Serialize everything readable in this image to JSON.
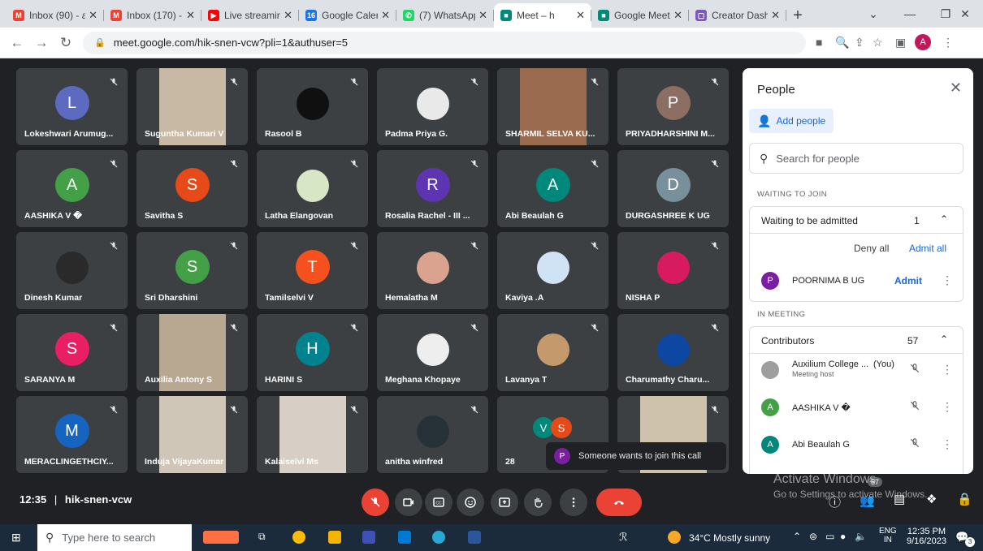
{
  "browser": {
    "tabs": [
      {
        "label": "Inbox (90) - a",
        "fav_color": "#ea4335",
        "fav_glyph": "M"
      },
      {
        "label": "Inbox (170) -",
        "fav_color": "#ea4335",
        "fav_glyph": "M"
      },
      {
        "label": "Live streamin",
        "fav_color": "#ff0000",
        "fav_glyph": "▶"
      },
      {
        "label": "Google Calen",
        "fav_color": "#1a73e8",
        "fav_glyph": "16"
      },
      {
        "label": "(7) WhatsApp",
        "fav_color": "#25d366",
        "fav_glyph": "✆"
      },
      {
        "label": "Meet – h",
        "fav_color": "#00897b",
        "fav_glyph": "■"
      },
      {
        "label": "Google Meet",
        "fav_color": "#00897b",
        "fav_glyph": "■"
      },
      {
        "label": "Creator Dash",
        "fav_color": "#7e57c2",
        "fav_glyph": "▢"
      }
    ],
    "new_tab": "+",
    "url": "meet.google.com/hik-snen-vcw?pli=1&authuser=5",
    "profile_initial": "A"
  },
  "participants": [
    {
      "name": "Lokeshwari Arumug...",
      "initial": "L",
      "color": "#5c6bc0",
      "type": "avatar"
    },
    {
      "name": "Suguntha Kumari V",
      "type": "video",
      "bg": "#c7b9a3"
    },
    {
      "name": "Rasool B",
      "type": "photo",
      "bg": "#101010"
    },
    {
      "name": "Padma Priya G.",
      "type": "photo",
      "bg": "#e9e9e9"
    },
    {
      "name": "SHARMIL SELVA KU...",
      "type": "video",
      "bg": "#9a6b4e"
    },
    {
      "name": "PRIYADHARSHINI M...",
      "initial": "P",
      "color": "#8d6e63",
      "type": "avatar"
    },
    {
      "name": "AASHIKA V �",
      "initial": "A",
      "color": "#43a047",
      "type": "avatar"
    },
    {
      "name": "Savitha S",
      "initial": "S",
      "color": "#e64a19",
      "type": "avatar"
    },
    {
      "name": "Latha Elangovan",
      "type": "photo",
      "bg": "#d7e6c5"
    },
    {
      "name": "Rosalia Rachel - III ...",
      "initial": "R",
      "color": "#5e35b1",
      "type": "avatar"
    },
    {
      "name": "Abi Beaulah G",
      "initial": "A",
      "color": "#00897b",
      "type": "avatar"
    },
    {
      "name": "DURGASHREE K UG",
      "initial": "D",
      "color": "#78909c",
      "type": "avatar"
    },
    {
      "name": "Dinesh Kumar",
      "type": "photo",
      "bg": "#2a2a2a"
    },
    {
      "name": "Sri Dharshini",
      "initial": "S",
      "color": "#43a047",
      "type": "avatar"
    },
    {
      "name": "Tamilselvi V",
      "initial": "T",
      "color": "#f4511e",
      "type": "avatar"
    },
    {
      "name": "Hemalatha M",
      "type": "photo",
      "bg": "#d9a38f"
    },
    {
      "name": "Kaviya .A",
      "type": "photo",
      "bg": "#cfe3f5"
    },
    {
      "name": "NISHA P",
      "type": "photo",
      "bg": "#d81b60"
    },
    {
      "name": "SARANYA M",
      "initial": "S",
      "color": "#e91e63",
      "type": "avatar"
    },
    {
      "name": "Auxilia Antony S",
      "type": "video",
      "bg": "#b9a891"
    },
    {
      "name": "HARINI S",
      "initial": "H",
      "color": "#00838f",
      "type": "avatar"
    },
    {
      "name": "Meghana Khopaye",
      "type": "photo",
      "bg": "#eeeeee"
    },
    {
      "name": "Lavanya T",
      "type": "photo",
      "bg": "#c49a6c"
    },
    {
      "name": "Charumathy Charu...",
      "type": "photo",
      "bg": "#0d47a1"
    },
    {
      "name": "MERACLINGETHCIY...",
      "initial": "M",
      "color": "#1565c0",
      "type": "avatar"
    },
    {
      "name": "Induja VijayaKumar",
      "type": "video",
      "bg": "#cfc6b8"
    },
    {
      "name": "Kalaiselvi Ms",
      "type": "video",
      "bg": "#d7cfc6"
    },
    {
      "name": "anitha winfred",
      "type": "photo",
      "bg": "#263238"
    },
    {
      "name": "28",
      "type": "more",
      "initials": [
        "V",
        "S"
      ],
      "colors": [
        "#00897b",
        "#e64a19"
      ]
    },
    {
      "name": "",
      "type": "video",
      "bg": "#cfc2ad"
    }
  ],
  "meeting": {
    "time": "12:35",
    "separator": "|",
    "code": "hik-snen-vcw"
  },
  "toast": {
    "avatar": "P",
    "text": "Someone wants to join this call"
  },
  "people": {
    "title": "People",
    "add_people": "Add people",
    "search_placeholder": "Search for people",
    "waiting_section": "WAITING TO JOIN",
    "waiting_label": "Waiting to be admitted",
    "waiting_count": "1",
    "deny_all": "Deny all",
    "admit_all": "Admit all",
    "waiting_person": {
      "name": "POORNIMA B UG",
      "initial": "P",
      "color": "#7b1fa2"
    },
    "admit": "Admit",
    "in_meeting_section": "IN MEETING",
    "contributors_label": "Contributors",
    "contributors_count": "57",
    "members": [
      {
        "name": "Auxilium College ...",
        "you": "(You)",
        "sub": "Meeting host",
        "color": "#9e9e9e",
        "initial": ""
      },
      {
        "name": "AASHIKA V �",
        "initial": "A",
        "color": "#43a047"
      },
      {
        "name": "Abi Beaulah G",
        "initial": "A",
        "color": "#00897b"
      }
    ],
    "people_count_badge": "57"
  },
  "watermark": {
    "line1": "Activate Windows",
    "line2": "Go to Settings to activate Windows."
  },
  "taskbar": {
    "search_placeholder": "Type here to search",
    "weather": "34°C  Mostly sunny",
    "lang1": "ENG",
    "lang2": "IN",
    "clock_time": "12:35 PM",
    "clock_date": "9/16/2023",
    "notif_count": "3"
  }
}
